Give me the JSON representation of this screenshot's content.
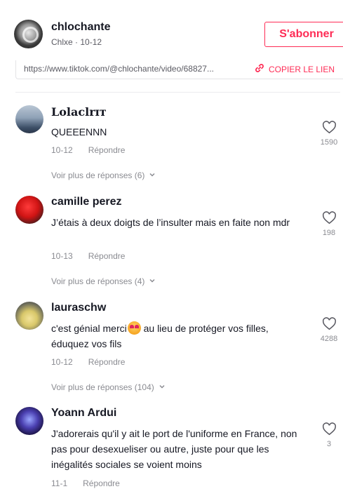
{
  "author": {
    "name": "chlochante",
    "subtitle": "Chlxe · 10-12",
    "follow_label": "S'abonner"
  },
  "share": {
    "url": "https://www.tiktok.com/@chlochante/video/68827...",
    "copy_label": "COPIER LE LIEN"
  },
  "comments": [
    {
      "name": "Lolaclrɪᴛ",
      "text": "QUEEENNN",
      "date": "10-12",
      "reply_label": "Répondre",
      "more_replies": "Voir plus de réponses (6)",
      "likes": "1590"
    },
    {
      "name": "camille perez",
      "text": "J’étais à deux doigts de l’insulter mais en faite non mdr",
      "date": "10-13",
      "reply_label": "Répondre",
      "more_replies": "Voir plus de réponses (4)",
      "likes": "198"
    },
    {
      "name": "lauraschw",
      "text_before": "c'est génial merci",
      "text_after": " au lieu de protéger vos filles, éduquez vos fils",
      "emoji": "smiling-face-with-hearts",
      "date": "10-12",
      "reply_label": "Répondre",
      "more_replies": "Voir plus de réponses (104)",
      "likes": "4288"
    },
    {
      "name": "Yoann Ardui",
      "text": "J'adorerais qu'il y ait le port de l'uniforme en France, non pas pour desexueliser ou autre, juste pour que les inégalités sociales se voient moins",
      "date": "11-1",
      "reply_label": "Répondre",
      "likes": "3"
    }
  ],
  "colors": {
    "accent": "#fe2c55",
    "text": "#161823",
    "muted": "#8a8b91"
  },
  "icons": [
    "link-icon",
    "heart-outline-icon",
    "chevron-down-icon"
  ]
}
